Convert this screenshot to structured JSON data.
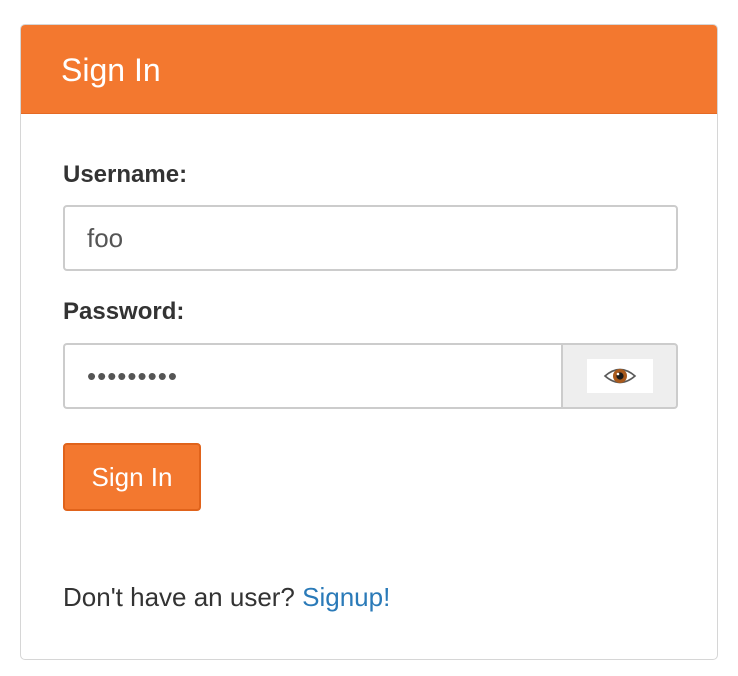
{
  "panel": {
    "title": "Sign In"
  },
  "form": {
    "username_label": "Username:",
    "username_value": "foo",
    "password_label": "Password:",
    "password_value": "foobarbaz",
    "submit_label": "Sign In"
  },
  "signup": {
    "prompt": "Don't have an user?",
    "link_label": "Signup!"
  },
  "icons": {
    "password_toggle": "eye-icon"
  },
  "colors": {
    "accent": "#f3782f",
    "link": "#2a7ab8"
  }
}
